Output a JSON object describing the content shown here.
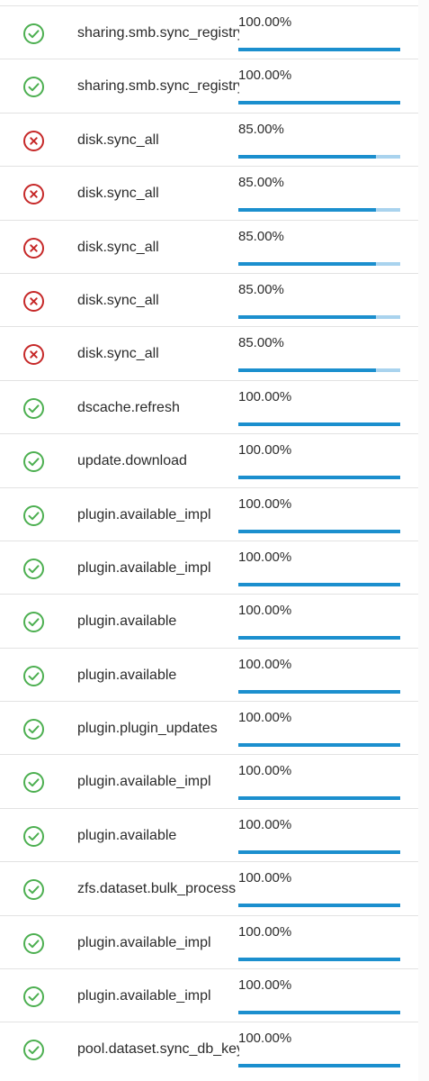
{
  "colors": {
    "success": "#4caf50",
    "failure": "#c62828",
    "progress_fill": "#1b8fce",
    "progress_track": "#a9d3ee"
  },
  "jobs": [
    {
      "name": "sharing.smb.sync_registry",
      "status": "success",
      "progress_text": "100.00%",
      "progress": 1.0
    },
    {
      "name": "sharing.smb.sync_registry",
      "status": "success",
      "progress_text": "100.00%",
      "progress": 1.0
    },
    {
      "name": "disk.sync_all",
      "status": "failed",
      "progress_text": "85.00%",
      "progress": 0.85
    },
    {
      "name": "disk.sync_all",
      "status": "failed",
      "progress_text": "85.00%",
      "progress": 0.85
    },
    {
      "name": "disk.sync_all",
      "status": "failed",
      "progress_text": "85.00%",
      "progress": 0.85
    },
    {
      "name": "disk.sync_all",
      "status": "failed",
      "progress_text": "85.00%",
      "progress": 0.85
    },
    {
      "name": "disk.sync_all",
      "status": "failed",
      "progress_text": "85.00%",
      "progress": 0.85
    },
    {
      "name": "dscache.refresh",
      "status": "success",
      "progress_text": "100.00%",
      "progress": 1.0
    },
    {
      "name": "update.download",
      "status": "success",
      "progress_text": "100.00%",
      "progress": 1.0
    },
    {
      "name": "plugin.available_impl",
      "status": "success",
      "progress_text": "100.00%",
      "progress": 1.0
    },
    {
      "name": "plugin.available_impl",
      "status": "success",
      "progress_text": "100.00%",
      "progress": 1.0
    },
    {
      "name": "plugin.available",
      "status": "success",
      "progress_text": "100.00%",
      "progress": 1.0
    },
    {
      "name": "plugin.available",
      "status": "success",
      "progress_text": "100.00%",
      "progress": 1.0
    },
    {
      "name": "plugin.plugin_updates",
      "status": "success",
      "progress_text": "100.00%",
      "progress": 1.0
    },
    {
      "name": "plugin.available_impl",
      "status": "success",
      "progress_text": "100.00%",
      "progress": 1.0
    },
    {
      "name": "plugin.available",
      "status": "success",
      "progress_text": "100.00%",
      "progress": 1.0
    },
    {
      "name": "zfs.dataset.bulk_process",
      "status": "success",
      "progress_text": "100.00%",
      "progress": 1.0
    },
    {
      "name": "plugin.available_impl",
      "status": "success",
      "progress_text": "100.00%",
      "progress": 1.0
    },
    {
      "name": "plugin.available_impl",
      "status": "success",
      "progress_text": "100.00%",
      "progress": 1.0
    },
    {
      "name": "pool.dataset.sync_db_keys",
      "status": "success",
      "progress_text": "100.00%",
      "progress": 1.0
    }
  ]
}
